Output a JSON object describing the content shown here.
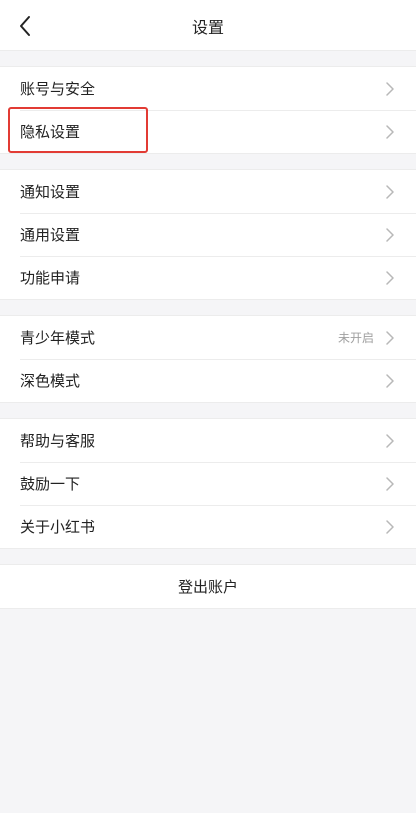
{
  "header": {
    "title": "设置",
    "back_icon": "chevron-left-icon"
  },
  "groups": [
    {
      "items": [
        {
          "label": "账号与安全"
        },
        {
          "label": "隐私设置",
          "highlighted": true
        }
      ]
    },
    {
      "items": [
        {
          "label": "通知设置"
        },
        {
          "label": "通用设置"
        },
        {
          "label": "功能申请"
        }
      ]
    },
    {
      "items": [
        {
          "label": "青少年模式",
          "value": "未开启"
        },
        {
          "label": "深色模式"
        }
      ]
    },
    {
      "items": [
        {
          "label": "帮助与客服"
        },
        {
          "label": "鼓励一下"
        },
        {
          "label": "关于小红书"
        }
      ]
    }
  ],
  "logout": {
    "label": "登出账户"
  },
  "colors": {
    "highlight": "#e23b34",
    "background": "#f5f5f7",
    "chevron": "#b8b8b8"
  }
}
